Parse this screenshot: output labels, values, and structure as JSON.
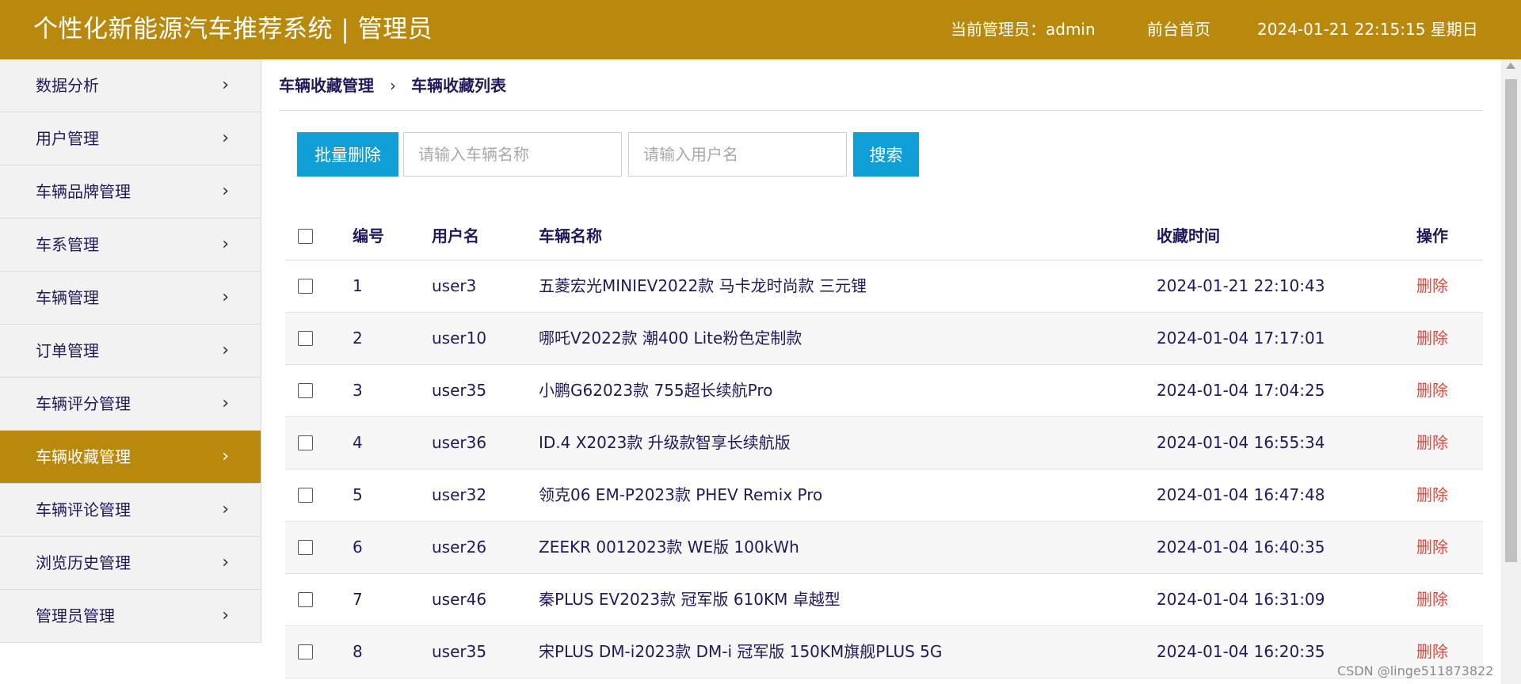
{
  "header": {
    "title": "个性化新能源汽车推荐系统 | 管理员",
    "admin_label": "当前管理员：admin",
    "home_link": "前台首页",
    "datetime": "2024-01-21  22:15:15  星期日"
  },
  "sidebar": {
    "items": [
      {
        "label": "数据分析",
        "active": false
      },
      {
        "label": "用户管理",
        "active": false
      },
      {
        "label": "车辆品牌管理",
        "active": false
      },
      {
        "label": "车系管理",
        "active": false
      },
      {
        "label": "车辆管理",
        "active": false
      },
      {
        "label": "订单管理",
        "active": false
      },
      {
        "label": "车辆评分管理",
        "active": false
      },
      {
        "label": "车辆收藏管理",
        "active": true
      },
      {
        "label": "车辆评论管理",
        "active": false
      },
      {
        "label": "浏览历史管理",
        "active": false
      },
      {
        "label": "管理员管理",
        "active": false
      }
    ]
  },
  "breadcrumb": {
    "parent": "车辆收藏管理",
    "separator": "›",
    "current": "车辆收藏列表"
  },
  "toolbar": {
    "batch_delete": "批量删除",
    "car_name_placeholder": "请输入车辆名称",
    "username_placeholder": "请输入用户名",
    "search": "搜索"
  },
  "table": {
    "headers": {
      "id": "编号",
      "username": "用户名",
      "car_name": "车辆名称",
      "time": "收藏时间",
      "action": "操作"
    },
    "rows": [
      {
        "id": "1",
        "username": "user3",
        "car_name": "五菱宏光MINIEV2022款 马卡龙时尚款 三元锂",
        "time": "2024-01-21 22:10:43",
        "action": "删除"
      },
      {
        "id": "2",
        "username": "user10",
        "car_name": "哪吒V2022款 潮400 Lite粉色定制款",
        "time": "2024-01-04 17:17:01",
        "action": "删除"
      },
      {
        "id": "3",
        "username": "user35",
        "car_name": "小鹏G62023款 755超长续航Pro",
        "time": "2024-01-04 17:04:25",
        "action": "删除"
      },
      {
        "id": "4",
        "username": "user36",
        "car_name": "ID.4 X2023款 升级款智享长续航版",
        "time": "2024-01-04 16:55:34",
        "action": "删除"
      },
      {
        "id": "5",
        "username": "user32",
        "car_name": "领克06 EM-P2023款 PHEV Remix Pro",
        "time": "2024-01-04 16:47:48",
        "action": "删除"
      },
      {
        "id": "6",
        "username": "user26",
        "car_name": "ZEEKR 0012023款 WE版 100kWh",
        "time": "2024-01-04 16:40:35",
        "action": "删除"
      },
      {
        "id": "7",
        "username": "user46",
        "car_name": "秦PLUS EV2023款 冠军版 610KM 卓越型",
        "time": "2024-01-04 16:31:09",
        "action": "删除"
      },
      {
        "id": "8",
        "username": "user35",
        "car_name": "宋PLUS DM-i2023款 DM-i 冠军版 150KM旗舰PLUS 5G",
        "time": "2024-01-04 16:20:35",
        "action": "删除"
      }
    ]
  },
  "watermark": "CSDN @linge511873822",
  "colors": {
    "brand": "#b8890d",
    "primary_button": "#0f9fd6",
    "delete_link": "#e0483c",
    "text": "#1f1a5a"
  }
}
